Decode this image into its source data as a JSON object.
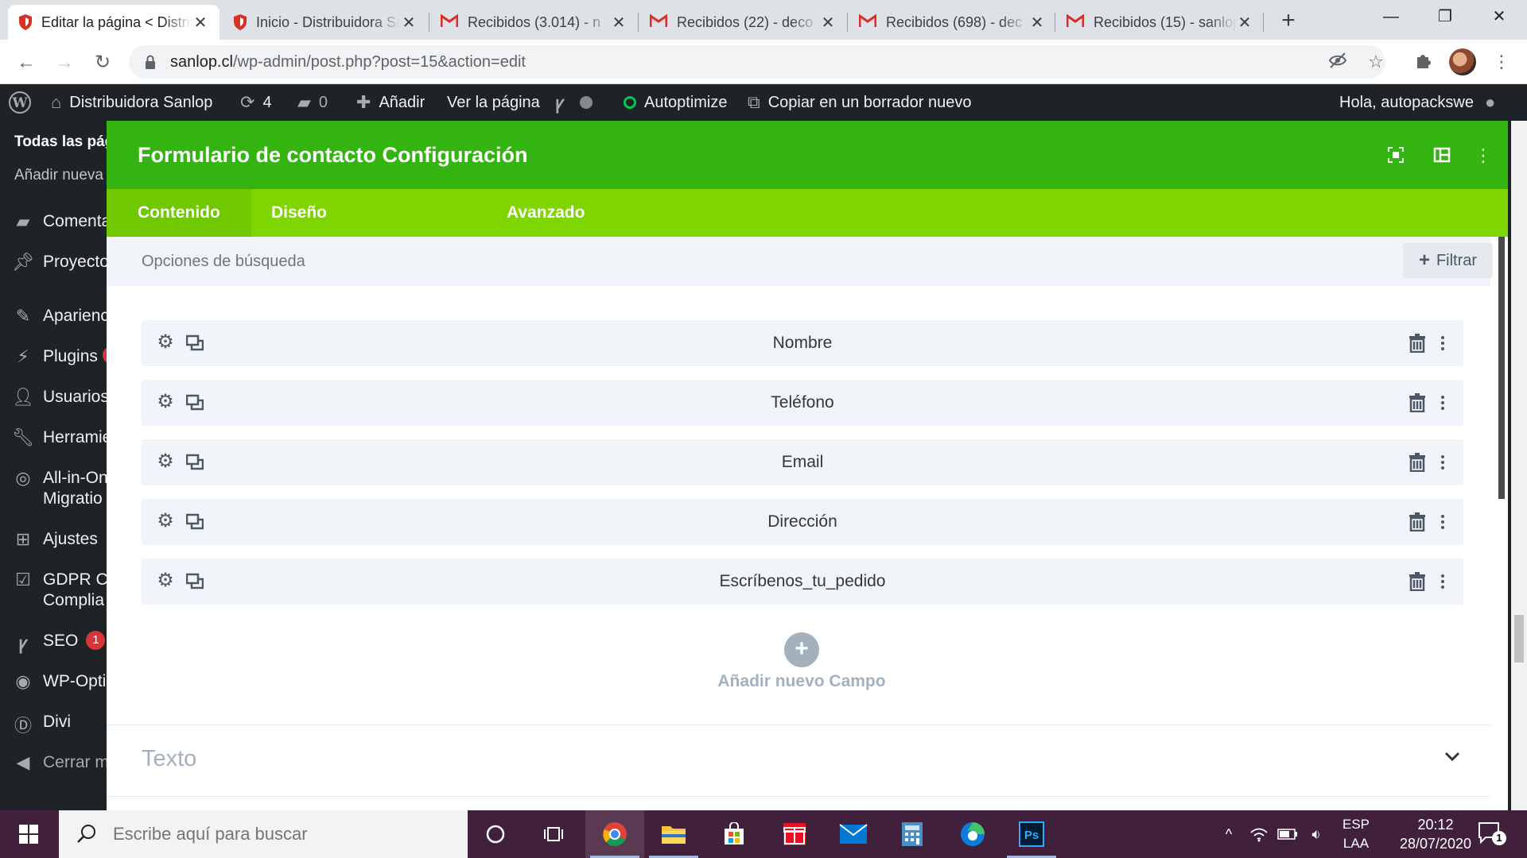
{
  "browser": {
    "tabs": [
      {
        "title": "Editar la página < Distribuidora Sanlop — WordPress",
        "icon": "shield-icon",
        "active": true
      },
      {
        "title": "Inicio - Distribuidora Sanlop",
        "icon": "shield-icon",
        "active": false
      },
      {
        "title": "Recibidos (3.014) - n",
        "icon": "gmail-icon",
        "active": false
      },
      {
        "title": "Recibidos (22) - deco",
        "icon": "gmail-icon",
        "active": false
      },
      {
        "title": "Recibidos (698) - dec",
        "icon": "gmail-icon",
        "active": false
      },
      {
        "title": "Recibidos (15) - sanlop",
        "icon": "gmail-icon",
        "active": false
      }
    ],
    "url_host": "sanlop.cl",
    "url_path": "/wp-admin/post.php?post=15&action=edit"
  },
  "adminbar": {
    "site_name": "Distribuidora Sanlop",
    "updates_count": "4",
    "comments_count": "0",
    "add_label": "Añadir",
    "view_page_label": "Ver la página",
    "autoptimize_label": "Autoptimize",
    "copy_draft_label": "Copiar en un borrador nuevo",
    "greeting": "Hola, autopackswe"
  },
  "sidebar": {
    "sub_items": [
      "Todas las pág",
      "Añadir nueva"
    ],
    "items": [
      {
        "label": "Comenta",
        "icon": "comments-icon"
      },
      {
        "label": "Proyecto",
        "icon": "pin-icon"
      },
      {
        "label": "Aparienc",
        "icon": "brush-icon"
      },
      {
        "label": "Plugins",
        "icon": "plugin-icon"
      },
      {
        "label": "Usuarios",
        "icon": "user-icon"
      },
      {
        "label": "Herramie",
        "icon": "wrench-icon"
      },
      {
        "label": "All-in-On",
        "label2": "Migratio",
        "icon": "migration-icon"
      },
      {
        "label": "Ajustes",
        "icon": "settings-icon"
      },
      {
        "label": "GDPR Co",
        "label2": "Complia",
        "icon": "check-icon"
      },
      {
        "label": "SEO",
        "badge": "1",
        "icon": "yoast-icon"
      },
      {
        "label": "WP-Opti",
        "icon": "wpoptimize-icon"
      },
      {
        "label": "Divi",
        "icon": "divi-icon"
      },
      {
        "label": "Cerrar me",
        "icon": "collapse-icon"
      }
    ]
  },
  "modal": {
    "title": "Formulario de contacto Configuración",
    "tabs": [
      "Contenido",
      "Diseño",
      "Avanzado"
    ],
    "active_tab": 0,
    "search_placeholder": "Opciones de búsqueda",
    "filter_label": "Filtrar",
    "fields": [
      "Nombre",
      "Teléfono",
      "Email",
      "Dirección",
      "Escríbenos_tu_pedido"
    ],
    "add_field_label": "Añadir nuevo Campo",
    "next_section": "Texto"
  },
  "taskbar": {
    "search_placeholder": "Escribe aquí para buscar",
    "lang_top": "ESP",
    "lang_bottom": "LAA",
    "time": "20:12",
    "date": "28/07/2020",
    "notifications": "1"
  },
  "colors": {
    "divi_header": "#33b411",
    "divi_tabs": "#7ed500",
    "wp_dark": "#1d2327"
  }
}
